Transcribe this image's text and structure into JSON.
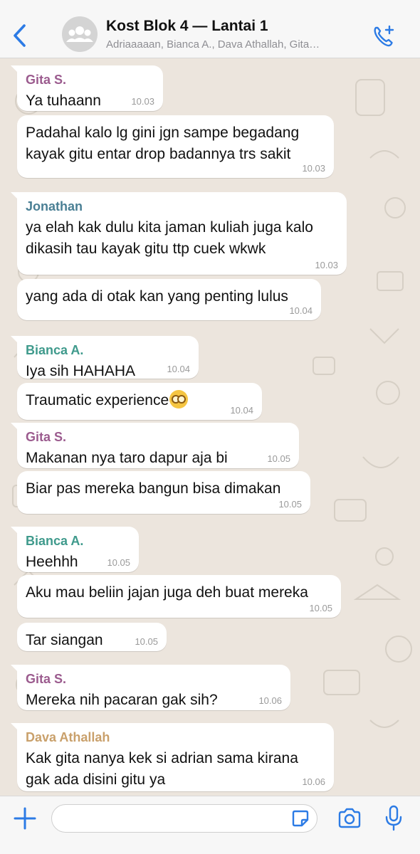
{
  "header": {
    "title": "Kost Blok 4 — Lantai 1",
    "subtitle": "Adriaaaaan, Bianca A., Dava Athallah, Gita…",
    "accent": "#2c7be5"
  },
  "messages": [
    {
      "sender": "Gita S.",
      "text": "Ya tuhaann",
      "time": "10.03"
    },
    {
      "text": "Padahal kalo lg gini jgn sampe begadang\nkayak gitu entar drop badannya trs sakit",
      "time": "10.03"
    },
    {
      "sender": "Jonathan",
      "text": "ya elah kak dulu kita jaman kuliah juga kalo\ndikasih tau kayak gitu ttp cuek wkwk",
      "time": "10.03"
    },
    {
      "text": "yang ada di otak kan yang penting lulus",
      "time": "10.04"
    },
    {
      "sender": "Bianca A.",
      "text": "Iya sih HAHAHA",
      "time": "10.04"
    },
    {
      "text": "Traumatic experience",
      "emoji": "dizzy-face-emoji",
      "time": "10.04"
    },
    {
      "sender": "Gita S.",
      "text": "Makanan nya taro dapur aja bi",
      "time": "10.05"
    },
    {
      "text": "Biar pas mereka bangun bisa dimakan",
      "time": "10.05"
    },
    {
      "sender": "Bianca A.",
      "text": "Heehhh",
      "time": "10.05"
    },
    {
      "text": "Aku mau beliin jajan juga deh buat mereka",
      "time": "10.05"
    },
    {
      "text": "Tar siangan",
      "time": "10.05"
    },
    {
      "sender": "Gita S.",
      "text": "Mereka nih pacaran gak sih?",
      "time": "10.06"
    },
    {
      "sender": "Dava Athallah",
      "text": "Kak gita nanya kek si adrian sama kirana\ngak ada disini gitu ya",
      "time": "10.06"
    }
  ],
  "sender_colors": {
    "Gita S.": "#9b5b8e",
    "Jonathan": "#4a7f94",
    "Bianca A.": "#3f9a8c",
    "Dava Athallah": "#c9a06b"
  },
  "icons": {
    "back": "chevron-left-icon",
    "avatar": "group-avatar-icon",
    "call": "add-call-icon",
    "plus": "plus-icon",
    "sticker": "sticker-icon",
    "camera": "camera-icon",
    "mic": "microphone-icon"
  },
  "input": {
    "placeholder": "",
    "value": ""
  }
}
